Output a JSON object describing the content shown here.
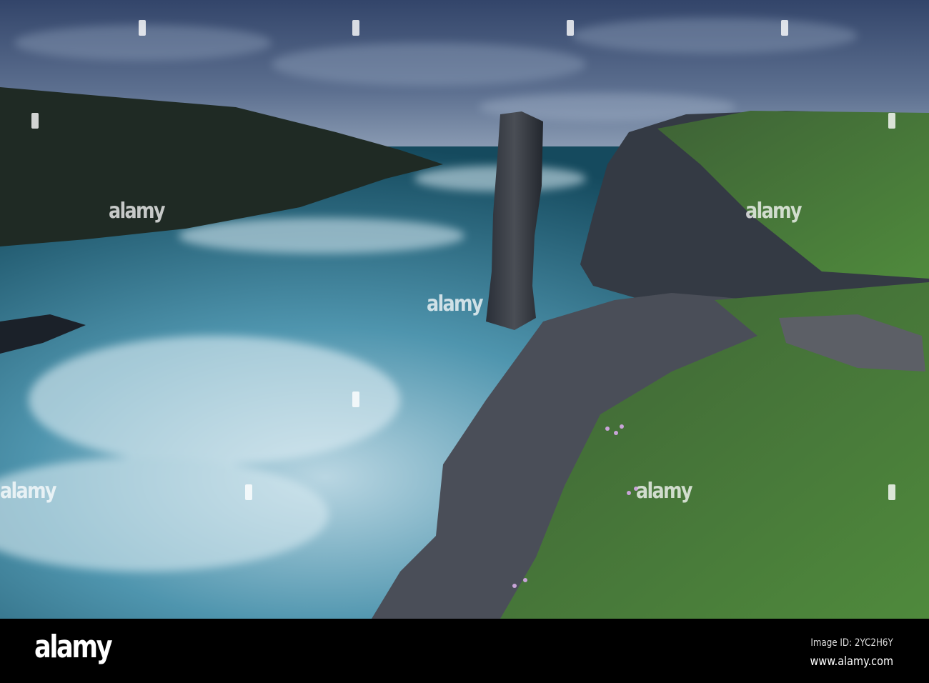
{
  "image": {
    "description_alt": "Sea stack beside cliffs under cloudy dusk sky",
    "colors": {
      "sky_top": "#34476a",
      "sky_horizon": "#8a9bb4",
      "sea": "#1f5a70",
      "foam": "#cfe3ec",
      "grass": "#4f7a3a",
      "rock": "#3c4048"
    }
  },
  "watermark": {
    "text": "alamy"
  },
  "footer": {
    "logo": "alamy",
    "image_id": "Image ID: 2YC2H6Y",
    "website": "www.alamy.com"
  }
}
